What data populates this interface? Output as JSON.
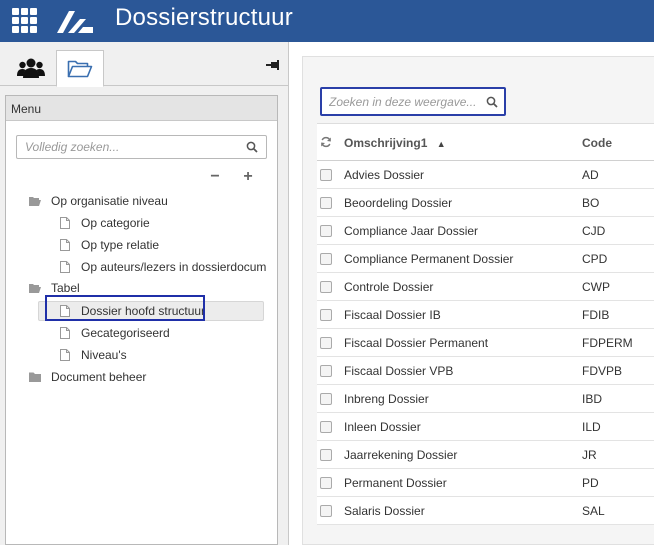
{
  "app": {
    "title": "Dossierstructuur"
  },
  "left": {
    "menu_label": "Menu",
    "search_placeholder": "Volledig zoeken...",
    "tree": [
      {
        "label": "Op organisatie niveau",
        "type": "folder-open"
      },
      {
        "label": "Op categorie",
        "type": "doc"
      },
      {
        "label": "Op type relatie",
        "type": "doc"
      },
      {
        "label": "Op auteurs/lezers in dossierdocum",
        "type": "doc"
      },
      {
        "label": "Tabel",
        "type": "folder-open"
      },
      {
        "label": "Dossier hoofd structuur",
        "type": "doc",
        "selected": true
      },
      {
        "label": "Gecategoriseerd",
        "type": "doc"
      },
      {
        "label": "Niveau's",
        "type": "doc"
      },
      {
        "label": "Document beheer",
        "type": "folder-closed"
      }
    ]
  },
  "right": {
    "search_placeholder": "Zoeken in deze weergave...",
    "columns": {
      "name": "Omschrijving1",
      "code": "Code"
    },
    "sort_indicator": "▲",
    "rows": [
      {
        "name": "Advies Dossier",
        "code": "AD"
      },
      {
        "name": "Beoordeling Dossier",
        "code": "BO"
      },
      {
        "name": "Compliance Jaar Dossier",
        "code": "CJD"
      },
      {
        "name": "Compliance Permanent Dossier",
        "code": "CPD"
      },
      {
        "name": "Controle Dossier",
        "code": "CWP"
      },
      {
        "name": "Fiscaal Dossier IB",
        "code": "FDIB"
      },
      {
        "name": "Fiscaal Dossier Permanent",
        "code": "FDPERM"
      },
      {
        "name": "Fiscaal Dossier VPB",
        "code": "FDVPB"
      },
      {
        "name": "Inbreng Dossier",
        "code": "IBD"
      },
      {
        "name": "Inleen Dossier",
        "code": "ILD"
      },
      {
        "name": "Jaarrekening Dossier",
        "code": "JR"
      },
      {
        "name": "Permanent Dossier",
        "code": "PD"
      },
      {
        "name": "Salaris Dossier",
        "code": "SAL"
      }
    ]
  },
  "colors": {
    "topbar": "#2b5797",
    "focus_outline": "#1f2fa8"
  }
}
